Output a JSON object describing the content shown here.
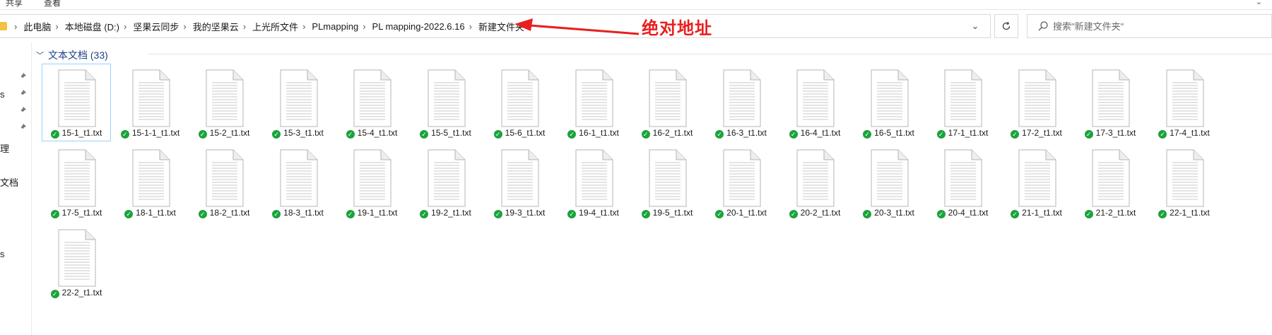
{
  "ribbon": {
    "tabs": [
      "共享",
      "查看"
    ]
  },
  "address": {
    "breadcrumbs": [
      "此电脑",
      "本地磁盘 (D:)",
      "坚果云同步",
      "我的坚果云",
      "上光所文件",
      "PLmapping",
      "PL mapping-2022.6.16",
      "新建文件夹"
    ]
  },
  "search": {
    "placeholder": "搜索\"新建文件夹\""
  },
  "annotation": {
    "label": "绝对地址",
    "color": "#e8201e"
  },
  "nav_fragments": [
    "s",
    "理",
    "文档",
    "s"
  ],
  "group": {
    "title": "文本文档 (33)"
  },
  "files": [
    "15-1_t1.txt",
    "15-1-1_t1.txt",
    "15-2_t1.txt",
    "15-3_t1.txt",
    "15-4_t1.txt",
    "15-5_t1.txt",
    "15-6_t1.txt",
    "16-1_t1.txt",
    "16-2_t1.txt",
    "16-3_t1.txt",
    "16-4_t1.txt",
    "16-5_t1.txt",
    "17-1_t1.txt",
    "17-2_t1.txt",
    "17-3_t1.txt",
    "17-4_t1.txt",
    "17-5_t1.txt",
    "18-1_t1.txt",
    "18-2_t1.txt",
    "18-3_t1.txt",
    "19-1_t1.txt",
    "19-2_t1.txt",
    "19-3_t1.txt",
    "19-4_t1.txt",
    "19-5_t1.txt",
    "20-1_t1.txt",
    "20-2_t1.txt",
    "20-3_t1.txt",
    "20-4_t1.txt",
    "21-1_t1.txt",
    "21-2_t1.txt",
    "22-1_t1.txt",
    "22-2_t1.txt"
  ],
  "selected_file": "15-1_t1.txt",
  "colors": {
    "sync_ok": "#1aa33c",
    "group_title": "#1e3f8a",
    "selection_border": "#99d1ff"
  }
}
